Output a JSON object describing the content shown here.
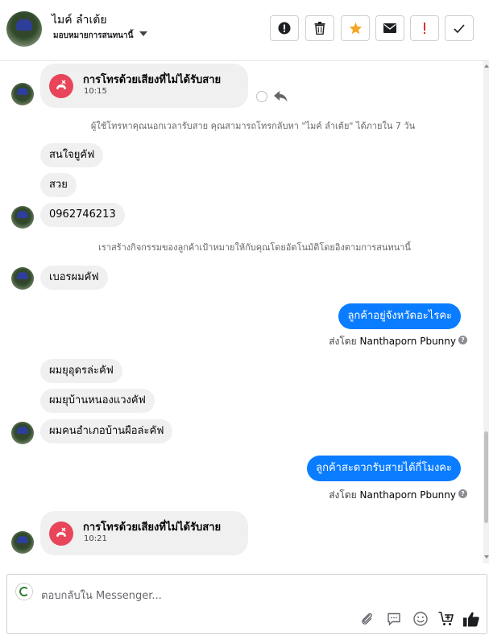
{
  "header": {
    "name": "ไมค์ ลำเต้ย",
    "subtitle": "มอบหมายการสนทนานี้",
    "actions": [
      {
        "name": "report-button",
        "icon": "alert-circle-icon"
      },
      {
        "name": "delete-button",
        "icon": "trash-icon"
      },
      {
        "name": "star-button",
        "icon": "star-icon"
      },
      {
        "name": "mark-unread-button",
        "icon": "envelope-icon"
      },
      {
        "name": "important-button",
        "icon": "exclamation-icon"
      },
      {
        "name": "done-button",
        "icon": "checkmark-icon"
      }
    ]
  },
  "messages": {
    "call1": {
      "title": "การโทรด้วยเสียงที่ไม่ได้รับสาย",
      "time": "10:15"
    },
    "sys1": "ผู้ใช้โทรหาคุณนอกเวลารับสาย คุณสามารถโทรกลับหา \"ไมค์ ลำเต้ย\" ได้ภายใน 7 วัน",
    "in1": "สนใจยูคัฟ",
    "in2": "สวย",
    "in3": "0962746213",
    "sys2": "เราสร้างกิจกรรมของลูกค้าเป้าหมายให้กับคุณโดยอัตโนมัติโดยอิงตามการสนทนานี้",
    "in4": "เบอรผมคัฟ",
    "out1": "ลูกค้าอยู่จังหวัดอะไรคะ",
    "sent_by_prefix": "ส่งโดย",
    "agent_name": "Nanthaporn Pbunny",
    "in5": "ผมยุอุดรล่ะคัฟ",
    "in6": "ผมยุบ้านหนองแวงคัฟ",
    "in7": "ผมคนอำเภอบ้านผือล่ะคัฟ",
    "out2": "ลูกค้าสะดวกรับสายได้กี่โมงคะ",
    "call2": {
      "title": "การโทรด้วยเสียงที่ไม่ได้รับสาย",
      "time": "10:21"
    }
  },
  "reply": {
    "placeholder": "ตอบกลับใน Messenger...",
    "tools": [
      "attach-icon",
      "saved-replies-icon",
      "emoji-icon",
      "add-to-cart-icon",
      "thumbs-up-icon"
    ]
  },
  "colors": {
    "accent": "#0a7cff",
    "missed_call": "#e8445a",
    "star": "#f5a623",
    "important": "#e02e2e"
  }
}
